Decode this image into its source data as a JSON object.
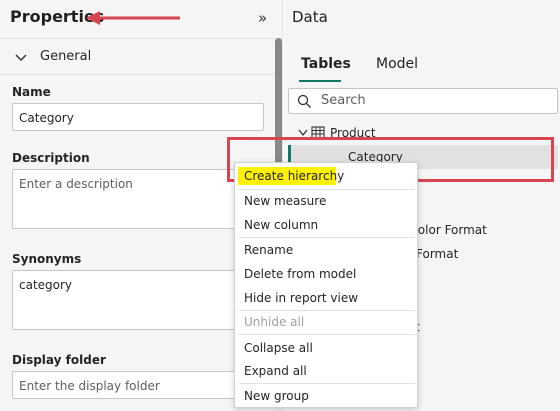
{
  "properties": {
    "title": "Properties",
    "collapse_glyph": "»",
    "section": "General",
    "name_label": "Name",
    "name_value": "Category",
    "description_label": "Description",
    "description_placeholder": "Enter a description",
    "synonyms_label": "Synonyms",
    "synonyms_value": "category",
    "display_folder_label": "Display folder",
    "display_folder_placeholder": "Enter the display folder"
  },
  "data_pane": {
    "title": "Data",
    "tabs": [
      "Tables",
      "Model"
    ],
    "search_placeholder": "Search",
    "table_name": "Product",
    "selected_field": "Category",
    "partial_fields": [
      "d Color Format",
      "Format",
      "t"
    ]
  },
  "context_menu": {
    "items": [
      "Create hierarchy",
      "New measure",
      "New column",
      "Rename",
      "Delete from model",
      "Hide in report view",
      "Unhide all",
      "Collapse all",
      "Expand all",
      "New group"
    ],
    "disabled": [
      "Unhide all"
    ]
  },
  "colors": {
    "accent": "#117865",
    "annotation_red": "#d64550",
    "highlight": "#fef200"
  }
}
